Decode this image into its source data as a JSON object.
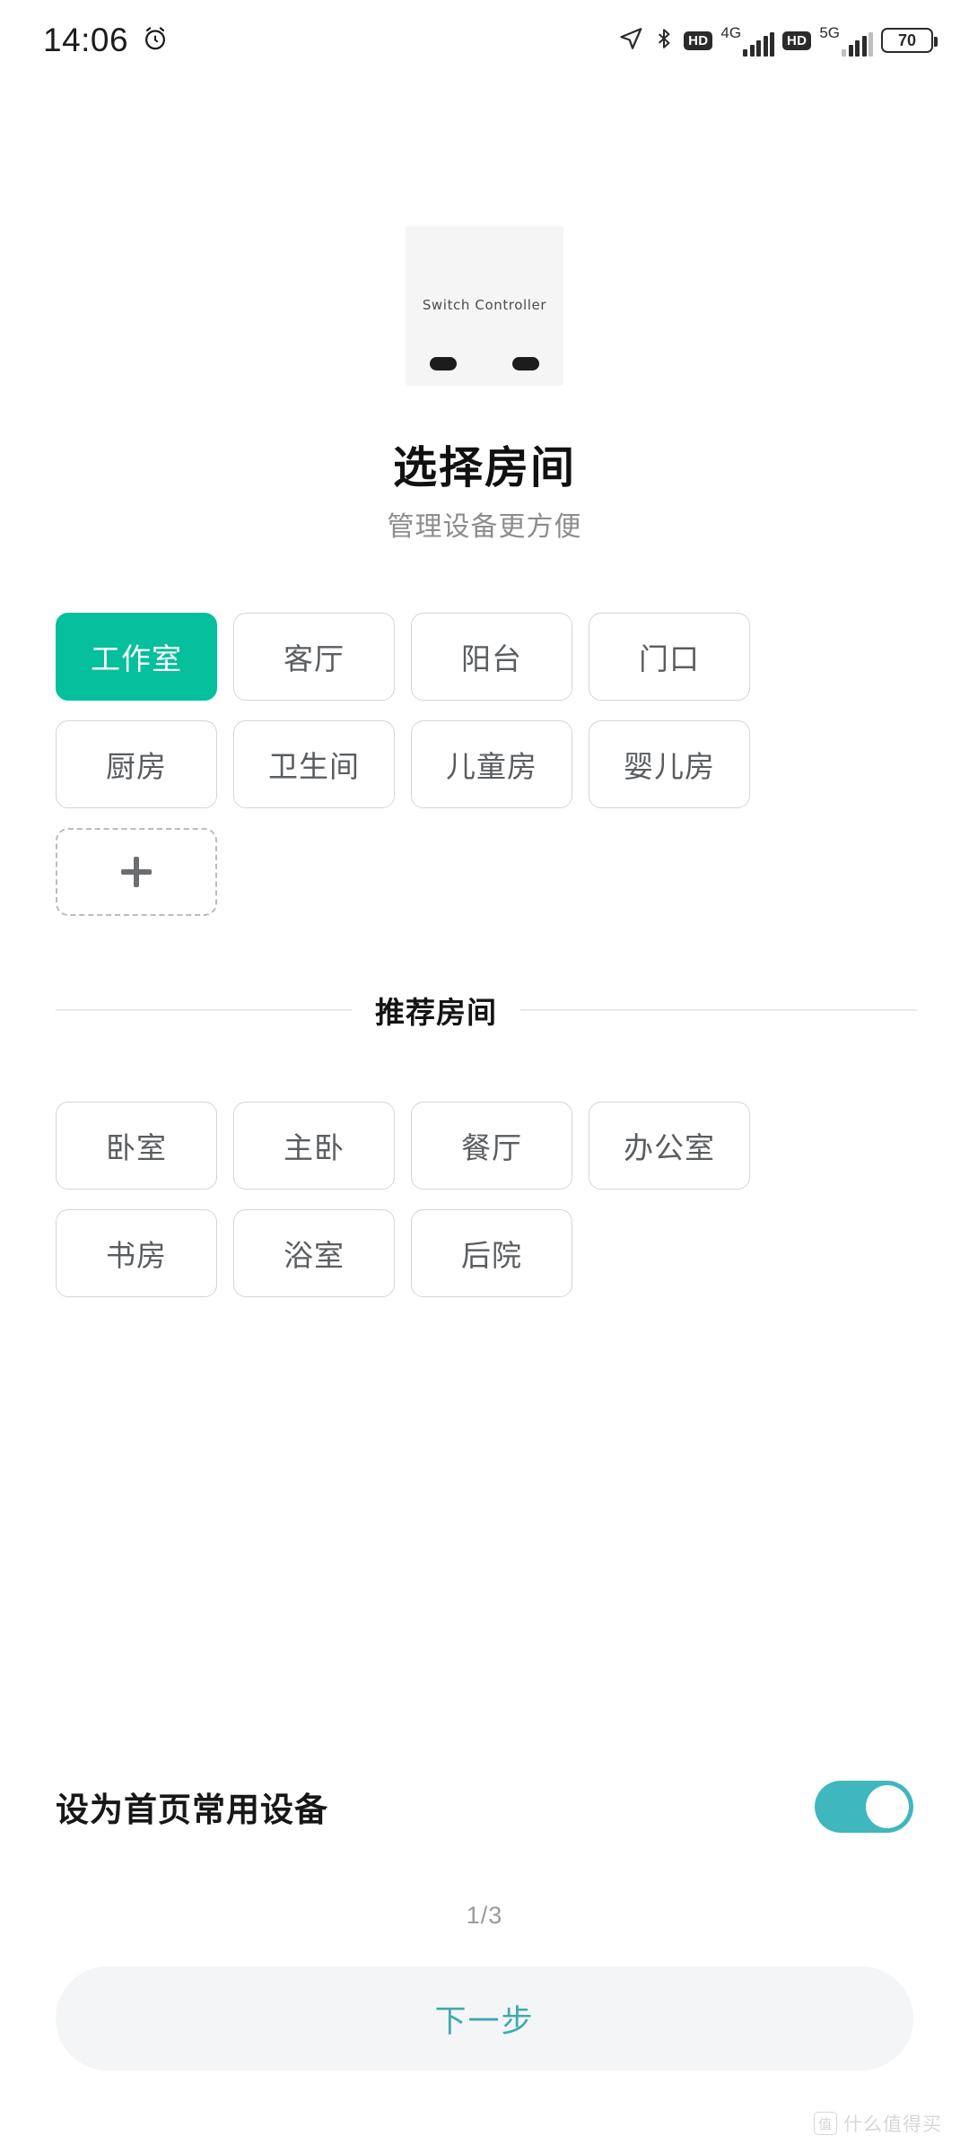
{
  "statusbar": {
    "time": "14:06",
    "alarm_icon": "alarm-clock-icon",
    "location_icon": "location-arrow-icon",
    "bluetooth_icon": "bluetooth-icon",
    "sim1": {
      "hd": "HD",
      "network": "4G"
    },
    "sim2": {
      "hd": "HD",
      "network": "5G"
    },
    "battery": "70"
  },
  "device": {
    "label": "Switch Controller"
  },
  "header": {
    "title": "选择房间",
    "subtitle": "管理设备更方便"
  },
  "my_rooms": {
    "chips": [
      {
        "label": "工作室",
        "selected": true
      },
      {
        "label": "客厅",
        "selected": false
      },
      {
        "label": "阳台",
        "selected": false
      },
      {
        "label": "门口",
        "selected": false
      },
      {
        "label": "厨房",
        "selected": false
      },
      {
        "label": "卫生间",
        "selected": false
      },
      {
        "label": "儿童房",
        "selected": false
      },
      {
        "label": "婴儿房",
        "selected": false
      }
    ],
    "add_button_icon": "plus-icon"
  },
  "recommend_section": {
    "title": "推荐房间",
    "chips": [
      {
        "label": "卧室"
      },
      {
        "label": "主卧"
      },
      {
        "label": "餐厅"
      },
      {
        "label": "办公室"
      },
      {
        "label": "书房"
      },
      {
        "label": "浴室"
      },
      {
        "label": "后院"
      }
    ]
  },
  "footer": {
    "toggle_label": "设为首页常用设备",
    "toggle_on": true,
    "page_indicator": "1/3",
    "next_label": "下一步"
  },
  "watermark": {
    "badge": "值",
    "text": "什么值得买"
  },
  "colors": {
    "accent_green": "#06bf9c",
    "toggle_teal": "#3fb7be",
    "next_text": "#3fa9b0",
    "next_bg": "#f4f5f6",
    "chip_border": "#d3d5d7",
    "chip_text": "#5a5d60"
  }
}
